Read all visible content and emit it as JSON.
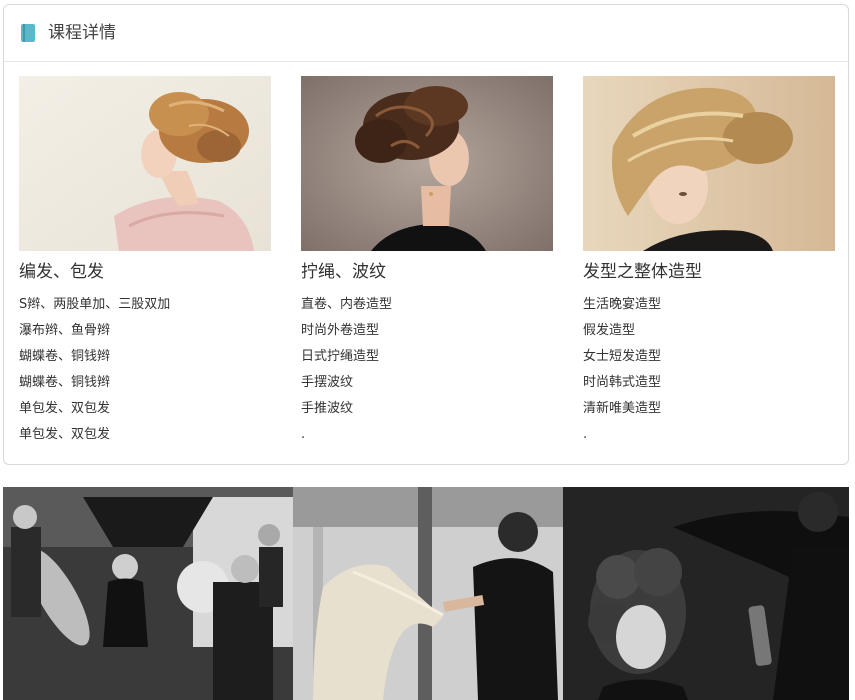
{
  "panel": {
    "title": "课程详情",
    "icon": "book-icon",
    "accent": "#5bb8c9"
  },
  "courses": [
    {
      "heading": "编发、包发",
      "items": [
        "S辫、两股单加、三股双加",
        "瀑布辫、鱼骨辫",
        "蝴蝶卷、铜钱辫",
        "蝴蝶卷、铜钱辫",
        "单包发、双包发",
        "单包发、双包发"
      ],
      "image": "updo-braid-woman-photo"
    },
    {
      "heading": "拧绳、波纹",
      "items": [
        "直卷、内卷造型",
        "时尚外卷造型",
        "日式拧绳造型",
        "手摆波纹",
        "手推波纹",
        "."
      ],
      "image": "curled-updo-woman-photo"
    },
    {
      "heading": "发型之整体造型",
      "items": [
        "生活晚宴造型",
        "假发造型",
        "女士短发造型",
        "时尚韩式造型",
        "清新唯美造型",
        "."
      ],
      "image": "blonde-side-chignon-photo"
    }
  ],
  "gallery": {
    "images": [
      "photo-studio-shoot",
      "stylist-cutting-long-hair",
      "stylist-spraying-curls"
    ]
  }
}
